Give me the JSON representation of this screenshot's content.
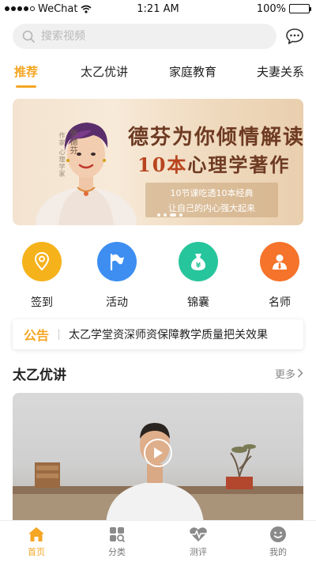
{
  "status_bar": {
    "carrier": "WeChat",
    "time": "1:21 AM",
    "battery": "100%"
  },
  "search": {
    "placeholder": "搜索视频"
  },
  "tabs": [
    {
      "label": "推荐",
      "active": true
    },
    {
      "label": "太乙优讲",
      "active": false
    },
    {
      "label": "家庭教育",
      "active": false
    },
    {
      "label": "夫妻关系",
      "active": false
    }
  ],
  "banner": {
    "side_text": "作家 心理学家",
    "name": "张德芬",
    "title_line1": "德芬为你倾情解读",
    "title_line2_highlight": "10本",
    "title_line2_rest": "心理学著作",
    "sub_line1": "10节课吃透10本经典",
    "sub_line2": "让自己的内心强大起来"
  },
  "quick_actions": [
    {
      "label": "签到",
      "icon": "location-pin-icon",
      "color": "#f5b21b"
    },
    {
      "label": "活动",
      "icon": "flag-icon",
      "color": "#3d8ef0"
    },
    {
      "label": "锦囊",
      "icon": "money-bag-icon",
      "color": "#27c59b"
    },
    {
      "label": "名师",
      "icon": "teacher-icon",
      "color": "#f5732a"
    }
  ],
  "notice": {
    "title": "公告",
    "text": "太乙学堂资深师资保障教学质量把关效果"
  },
  "section": {
    "title": "太乙优讲",
    "more": "更多"
  },
  "bottom_nav": [
    {
      "label": "首页",
      "icon": "home-icon",
      "active": true
    },
    {
      "label": "分类",
      "icon": "category-icon",
      "active": false
    },
    {
      "label": "测评",
      "icon": "heartbeat-icon",
      "active": false
    },
    {
      "label": "我的",
      "icon": "profile-icon",
      "active": false
    }
  ],
  "colors": {
    "accent": "#f5a623",
    "text": "#222222",
    "muted": "#888888"
  }
}
